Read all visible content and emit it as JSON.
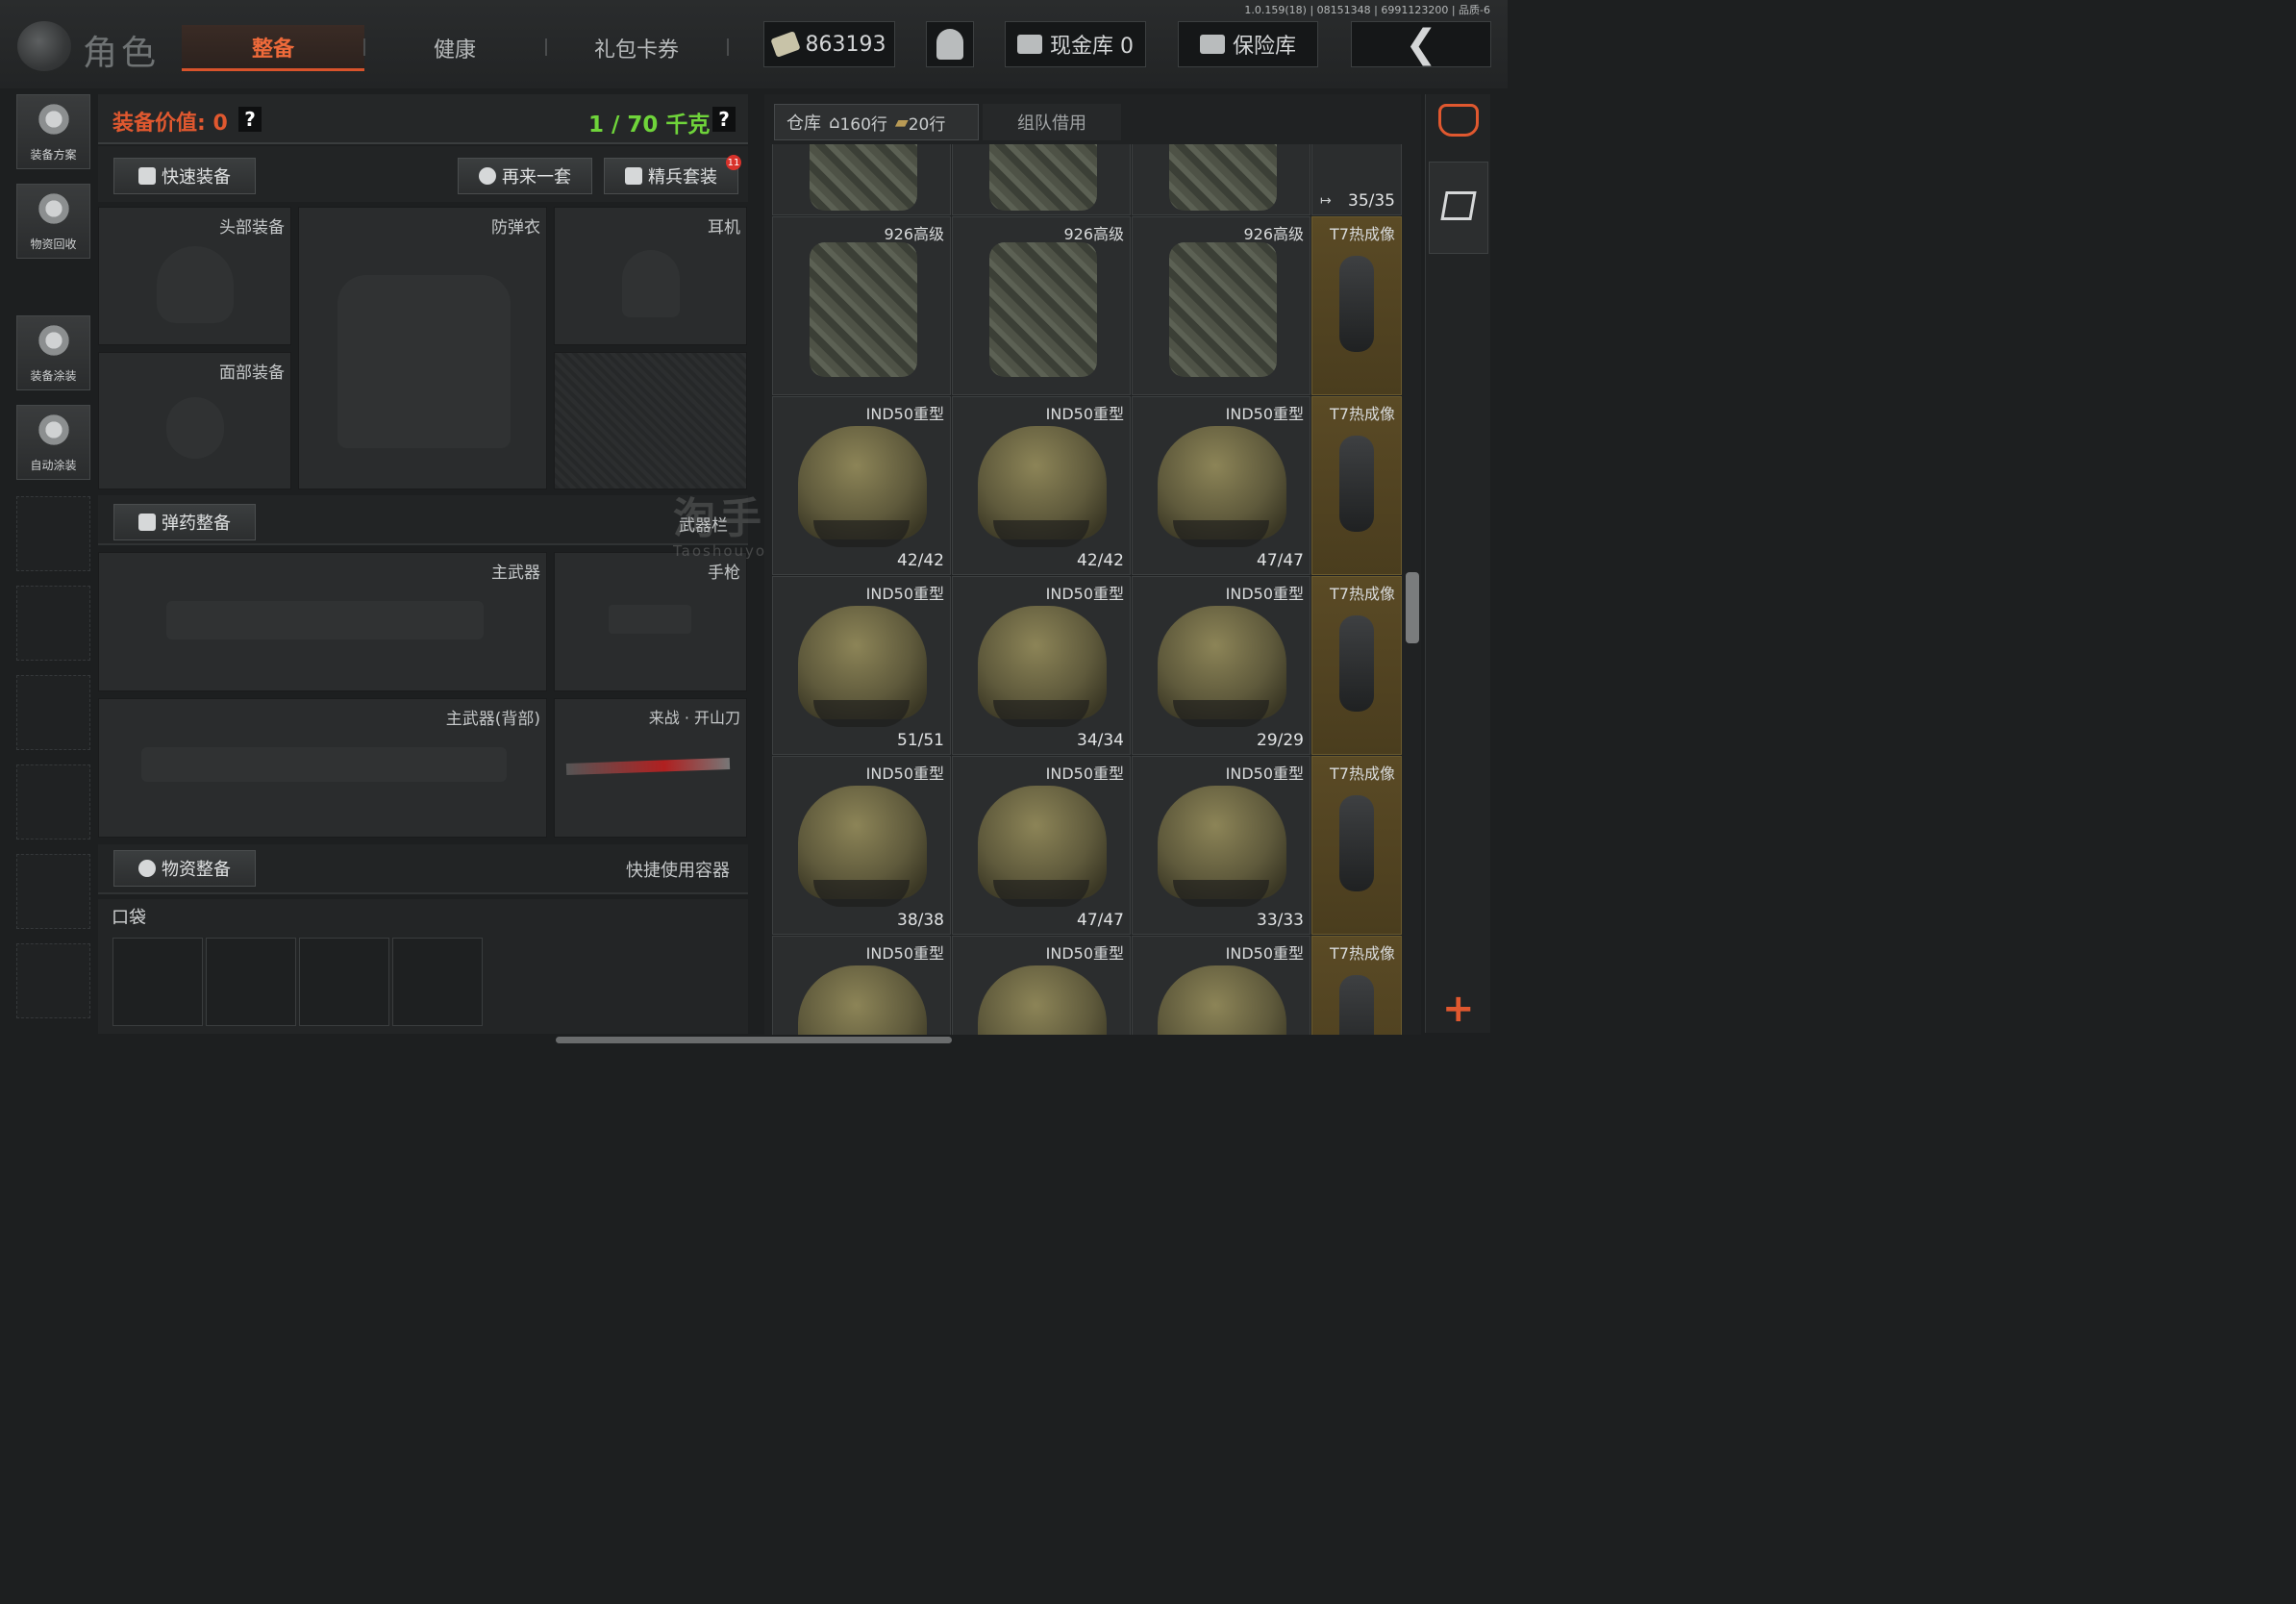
{
  "version": "1.0.159(18) | 08151348 | 6991123200 | 品质-6",
  "header": {
    "role_label": "角色",
    "tabs": [
      "整备",
      "健康",
      "礼包卡券"
    ],
    "currency": "863193",
    "cash_vault": "现金库 0",
    "safe_vault": "保险库"
  },
  "sidebar": [
    "装备方案",
    "物资回收",
    "装备涂装",
    "自动涂装"
  ],
  "equipment": {
    "value_label": "装备价值: 0",
    "weight_label": "1 / 70 千克",
    "help": "?",
    "quick_equip": "快速装备",
    "again": "再来一套",
    "elite": "精兵套装",
    "elite_badge": "11",
    "slots": {
      "head": "头部装备",
      "armor": "防弹衣",
      "earphone": "耳机",
      "face": "面部装备",
      "primary": "主武器",
      "pistol": "手枪",
      "primary_back": "主武器(背部)",
      "melee": "来战 · 开山刀"
    },
    "ammo_btn": "弹药整备",
    "weapon_bar": "武器栏",
    "supply_btn": "物资整备",
    "quick_container": "快捷使用容器",
    "pocket": "口袋"
  },
  "watermark": {
    "main": "淘手游",
    "sub": "Taoshouyou.Com"
  },
  "warehouse": {
    "tab_label": "仓库",
    "rows1": "160行",
    "rows2": "20行",
    "team_tab": "组队借用",
    "top_count": "35/35",
    "rows": [
      {
        "items": [
          {
            "name": "926高级",
            "dur": ""
          },
          {
            "name": "926高级",
            "dur": ""
          },
          {
            "name": "926高级",
            "dur": ""
          }
        ],
        "side": "T7热成像"
      },
      {
        "items": [
          {
            "name": "IND50重型",
            "dur": "42/42"
          },
          {
            "name": "IND50重型",
            "dur": "42/42"
          },
          {
            "name": "IND50重型",
            "dur": "47/47"
          }
        ],
        "side": "T7热成像"
      },
      {
        "items": [
          {
            "name": "IND50重型",
            "dur": "51/51"
          },
          {
            "name": "IND50重型",
            "dur": "34/34"
          },
          {
            "name": "IND50重型",
            "dur": "29/29"
          }
        ],
        "side": "T7热成像"
      },
      {
        "items": [
          {
            "name": "IND50重型",
            "dur": "38/38"
          },
          {
            "name": "IND50重型",
            "dur": "47/47"
          },
          {
            "name": "IND50重型",
            "dur": "33/33"
          }
        ],
        "side": "T7热成像"
      },
      {
        "items": [
          {
            "name": "IND50重型",
            "dur": ""
          },
          {
            "name": "IND50重型",
            "dur": ""
          },
          {
            "name": "IND50重型",
            "dur": ""
          }
        ],
        "side": "T7热成像"
      }
    ]
  },
  "rightbar": {
    "add": "+"
  },
  "colors": {
    "accent": "#e0582f",
    "green": "#6fd43a",
    "gold": "#5a4a25"
  }
}
